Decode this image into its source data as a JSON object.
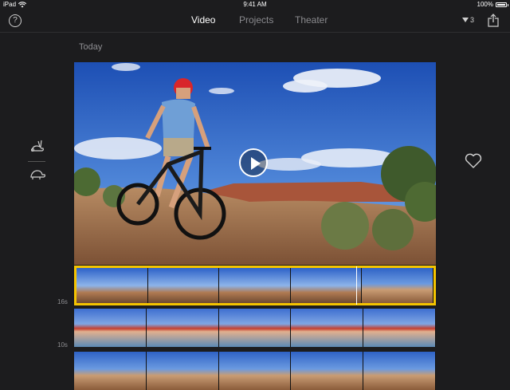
{
  "status_bar": {
    "device": "iPad",
    "time": "9:41 AM",
    "battery": "100%",
    "battery_level": 1.0,
    "wifi_icon": "wifi-icon",
    "battery_icon": "battery-icon"
  },
  "navbar": {
    "help_label": "?",
    "tabs": [
      {
        "label": "Video",
        "active": true
      },
      {
        "label": "Projects",
        "active": false
      },
      {
        "label": "Theater",
        "active": false
      }
    ],
    "sort_count": "3",
    "share_icon": "share-icon"
  },
  "section": {
    "label": "Today"
  },
  "speed_controls": {
    "fast_icon": "rabbit-icon",
    "slow_icon": "turtle-icon"
  },
  "preview": {
    "play_icon": "play-icon",
    "favorite_icon": "heart-icon"
  },
  "clips": [
    {
      "duration": "16s",
      "selected": true
    },
    {
      "duration": "10s",
      "selected": false
    },
    {
      "duration": "",
      "selected": false
    }
  ],
  "colors": {
    "selection": "#f5c400",
    "background": "#1c1c1e",
    "inactive_tab": "#8a8a8e"
  }
}
